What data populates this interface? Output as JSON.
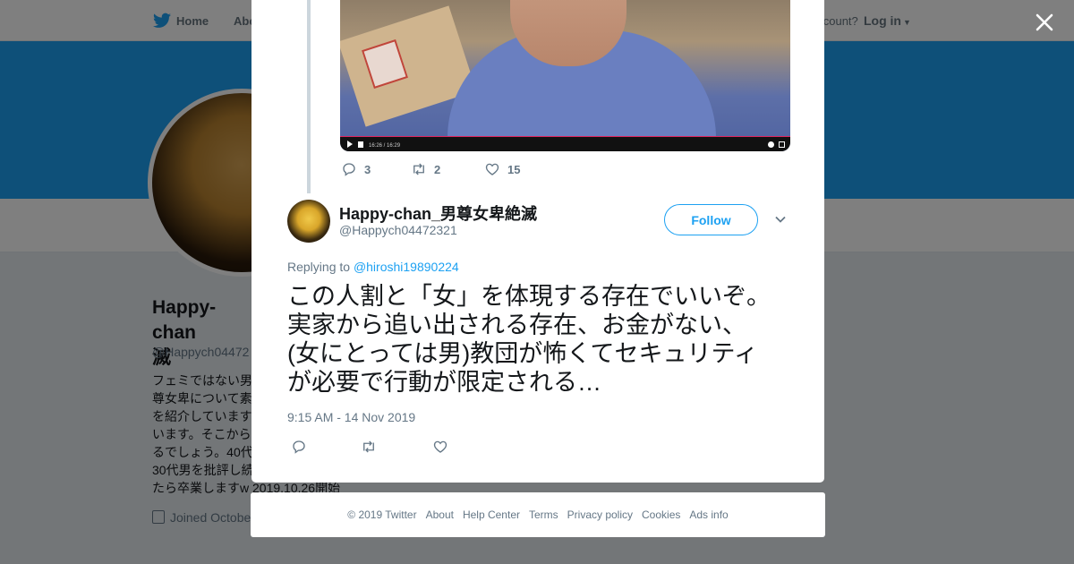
{
  "topbar": {
    "home_label": "Home",
    "about_label": "Abo",
    "account_text": "account?",
    "login_label": "Log in"
  },
  "profile": {
    "name": "Happy-chan 男尊女卑絶滅",
    "name_visible": "Happy-chan\n滅",
    "handle": "@Happych04472",
    "bio": "フェミではない男\n尊女卑について素\nを紹介しています\nいます。そこから\nるでしょう。40代\n30代男を批評し続\nたら卒業しますw 2019.10.26開始",
    "joined": "Joined Octobe"
  },
  "previous_tweet": {
    "replies": "3",
    "retweets": "2",
    "likes": "15",
    "video_time": "16:26 / 16:29"
  },
  "tweet": {
    "author_name": "Happy-chan_男尊女卑絶滅",
    "author_handle": "@Happych04472321",
    "follow_label": "Follow",
    "replying_prefix": "Replying to",
    "replying_to": "@hiroshi19890224",
    "text": "この人割と「女」を体現する存在でいいぞ。\n実家から追い出される存在、お金がない、\n(女にとっては男)教団が怖くてセキュリティ\nが必要で行動が限定される…",
    "timestamp": "9:15 AM - 14 Nov 2019"
  },
  "footer": {
    "copyright": "© 2019 Twitter",
    "about": "About",
    "help": "Help Center",
    "terms": "Terms",
    "privacy": "Privacy policy",
    "cookies": "Cookies",
    "ads": "Ads info"
  },
  "colors": {
    "brand_blue": "#1da1f2",
    "text_dark": "#14171a",
    "text_muted": "#657786",
    "overlay": "rgba(0,0,0,0.5)"
  },
  "icons": [
    "twitter-bird-icon",
    "close-icon",
    "reply-icon",
    "retweet-icon",
    "like-icon",
    "chevron-down-icon",
    "calendar-icon"
  ]
}
